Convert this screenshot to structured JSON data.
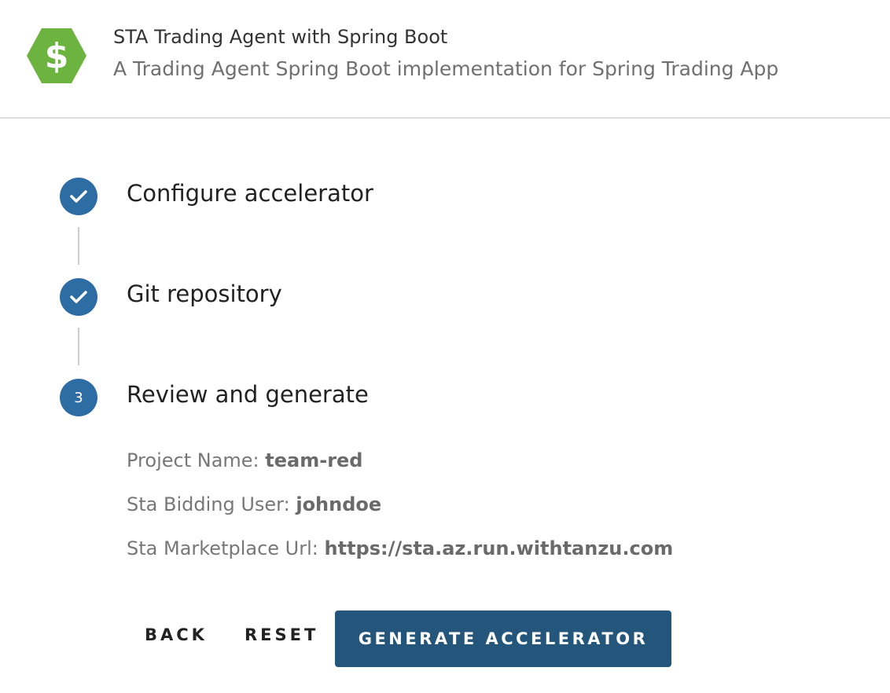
{
  "header": {
    "title": "STA Trading Agent with Spring Boot",
    "subtitle": "A Trading Agent Spring Boot implementation for Spring Trading App",
    "logo_icon": "dollar-hexagon-icon",
    "logo_symbol": "$",
    "logo_color": "#6db33f"
  },
  "steps": [
    {
      "label": "Configure accelerator",
      "status": "complete",
      "icon": "check-icon"
    },
    {
      "label": "Git repository",
      "status": "complete",
      "icon": "check-icon"
    },
    {
      "label": "Review and generate",
      "status": "active",
      "number": "3"
    }
  ],
  "review": [
    {
      "label": "Project Name:",
      "value": "team-red"
    },
    {
      "label": "Sta Bidding User:",
      "value": "johndoe"
    },
    {
      "label": "Sta Marketplace Url:",
      "value": "https://sta.az.run.withtanzu.com"
    }
  ],
  "buttons": {
    "back": "BACK",
    "reset": "RESET",
    "generate": "GENERATE ACCELERATOR"
  },
  "colors": {
    "step_circle": "#2e6da4",
    "primary_button": "#24557a",
    "divider": "#dddddd"
  }
}
